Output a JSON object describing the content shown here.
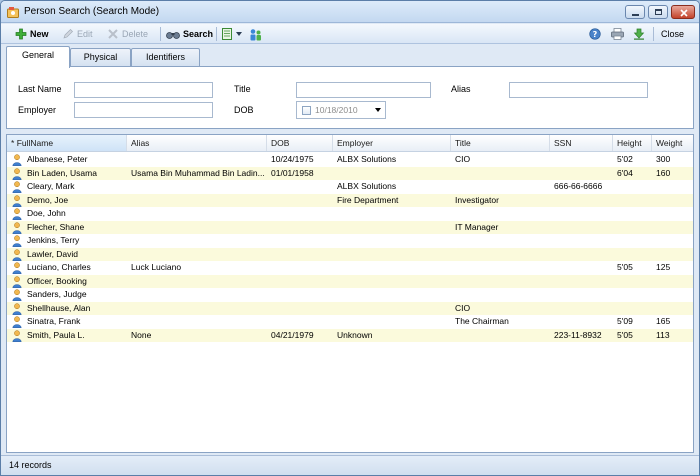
{
  "window": {
    "title": "Person Search (Search Mode)"
  },
  "toolbar": {
    "new_label": "New",
    "edit_label": "Edit",
    "delete_label": "Delete",
    "search_label": "Search",
    "close_label": "Close"
  },
  "tabs": [
    {
      "label": "General",
      "active": true
    },
    {
      "label": "Physical",
      "active": false
    },
    {
      "label": "Identifiers",
      "active": false
    }
  ],
  "form": {
    "last_name_label": "Last Name",
    "last_name_value": "",
    "title_label": "Title",
    "title_value": "",
    "alias_label": "Alias",
    "alias_value": "",
    "employer_label": "Employer",
    "employer_value": "",
    "dob_label": "DOB",
    "dob_value": "10/18/2010"
  },
  "grid": {
    "sort_indicator": "*",
    "columns": [
      "FullName",
      "Alias",
      "DOB",
      "Employer",
      "Title",
      "SSN",
      "Height",
      "Weight"
    ],
    "rows": [
      [
        "Albanese, Peter",
        "",
        "10/24/1975",
        "ALBX Solutions",
        "CIO",
        "",
        "5'02",
        "300"
      ],
      [
        "Bin Laden, Usama",
        "Usama Bin Muhammad Bin Ladin...",
        "01/01/1958",
        "",
        "",
        "",
        "6'04",
        "160"
      ],
      [
        "Cleary, Mark",
        "",
        "",
        "ALBX Solutions",
        "",
        "666-66-6666",
        "",
        ""
      ],
      [
        "Demo, Joe",
        "",
        "",
        "Fire Department",
        "Investigator",
        "",
        "",
        ""
      ],
      [
        "Doe, John",
        "",
        "",
        "",
        "",
        "",
        "",
        ""
      ],
      [
        "Flecher, Shane",
        "",
        "",
        "",
        "IT Manager",
        "",
        "",
        ""
      ],
      [
        "Jenkins, Terry",
        "",
        "",
        "",
        "",
        "",
        "",
        ""
      ],
      [
        "Lawler, David",
        "",
        "",
        "",
        "",
        "",
        "",
        ""
      ],
      [
        "Luciano, Charles",
        "Luck Luciano",
        "",
        "",
        "",
        "",
        "5'05",
        "125"
      ],
      [
        "Officer, Booking",
        "",
        "",
        "",
        "",
        "",
        "",
        ""
      ],
      [
        "Sanders, Judge",
        "",
        "",
        "",
        "",
        "",
        "",
        ""
      ],
      [
        "Shellhause, Alan",
        "",
        "",
        "",
        "CIO",
        "",
        "",
        ""
      ],
      [
        "Sinatra, Frank",
        "",
        "",
        "",
        "The Chairman",
        "",
        "5'09",
        "165"
      ],
      [
        "Smith, Paula L.",
        "None",
        "04/21/1979",
        "Unknown",
        "",
        "223-11-8932",
        "5'05",
        "113"
      ]
    ]
  },
  "status": {
    "record_count": "14 records"
  },
  "icons": {
    "app": "person-search-app-icon",
    "new": "green-plus-icon",
    "edit": "pencil-icon",
    "delete": "delete-x-icon",
    "search": "binoculars-icon",
    "export": "spreadsheet-icon",
    "filter": "people-filter-icon",
    "help": "help-icon",
    "print": "printer-icon",
    "save": "download-icon",
    "row": "person-icon"
  },
  "colors": {
    "alt_row": "#fbfadc",
    "header_sorted": "#cfe3f7",
    "window_border": "#5b7ea8"
  }
}
